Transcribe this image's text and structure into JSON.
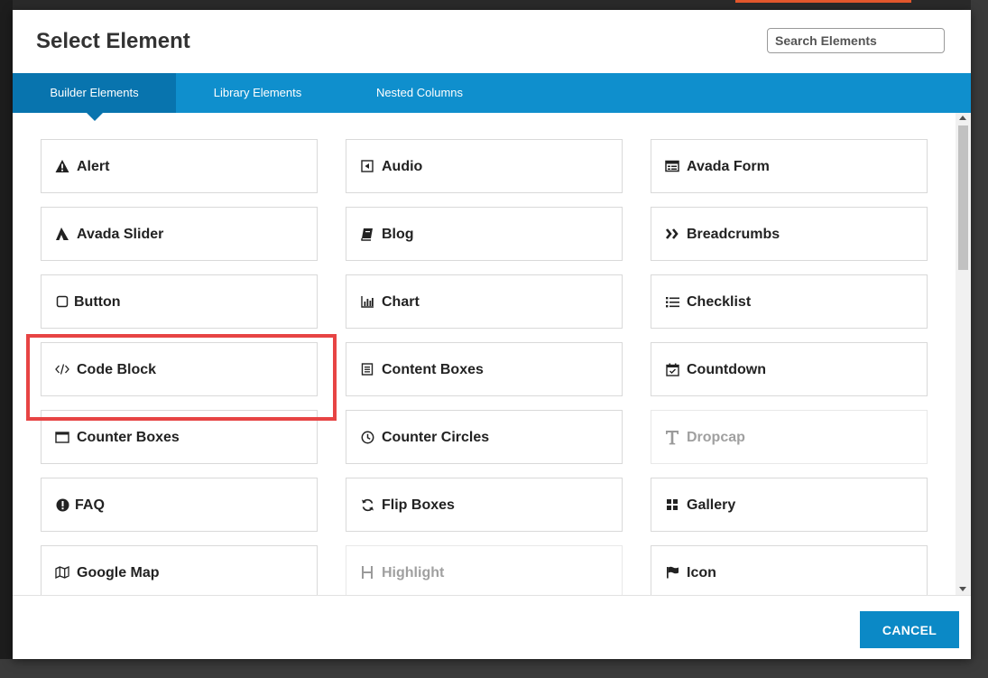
{
  "modal": {
    "title": "Select Element",
    "search_placeholder": "Search Elements"
  },
  "tabs": [
    {
      "label": "Builder Elements",
      "active": true
    },
    {
      "label": "Library Elements",
      "active": false
    },
    {
      "label": "Nested Columns",
      "active": false
    }
  ],
  "elements": [
    {
      "label": "Alert",
      "icon": "warning-icon",
      "disabled": false
    },
    {
      "label": "Audio",
      "icon": "audio-icon",
      "disabled": false
    },
    {
      "label": "Avada Form",
      "icon": "form-icon",
      "disabled": false
    },
    {
      "label": "Avada Slider",
      "icon": "avada-icon",
      "disabled": false
    },
    {
      "label": "Blog",
      "icon": "book-icon",
      "disabled": false
    },
    {
      "label": "Breadcrumbs",
      "icon": "double-chevron-icon",
      "disabled": false
    },
    {
      "label": "Button",
      "icon": "square-icon",
      "disabled": false
    },
    {
      "label": "Chart",
      "icon": "chart-icon",
      "disabled": false
    },
    {
      "label": "Checklist",
      "icon": "list-icon",
      "disabled": false
    },
    {
      "label": "Code Block",
      "icon": "code-icon",
      "disabled": false,
      "highlighted": true
    },
    {
      "label": "Content Boxes",
      "icon": "content-boxes-icon",
      "disabled": false
    },
    {
      "label": "Countdown",
      "icon": "calendar-icon",
      "disabled": false
    },
    {
      "label": "Counter Boxes",
      "icon": "counter-box-icon",
      "disabled": false
    },
    {
      "label": "Counter Circles",
      "icon": "clock-icon",
      "disabled": false
    },
    {
      "label": "Dropcap",
      "icon": "dropcap-icon",
      "disabled": true
    },
    {
      "label": "FAQ",
      "icon": "info-circle-icon",
      "disabled": false
    },
    {
      "label": "Flip Boxes",
      "icon": "flip-icon",
      "disabled": false
    },
    {
      "label": "Gallery",
      "icon": "gallery-icon",
      "disabled": false
    },
    {
      "label": "Google Map",
      "icon": "map-icon",
      "disabled": false
    },
    {
      "label": "Highlight",
      "icon": "highlight-icon",
      "disabled": true
    },
    {
      "label": "Icon",
      "icon": "flag-icon",
      "disabled": false
    }
  ],
  "footer": {
    "cancel_label": "CANCEL"
  },
  "colors": {
    "tab_bar": "#0f8fcd",
    "tab_active": "#0874ae",
    "cancel_button": "#0b89c6",
    "highlight_outline": "#e74444"
  }
}
